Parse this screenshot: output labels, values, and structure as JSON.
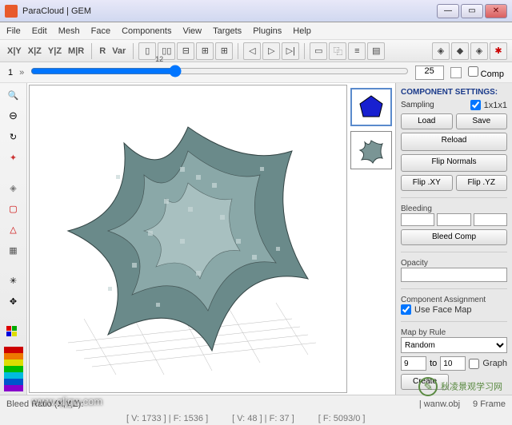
{
  "window": {
    "title": "ParaCloud | GEM"
  },
  "menu": [
    "File",
    "Edit",
    "Mesh",
    "Face",
    "Components",
    "View",
    "Targets",
    "Plugins",
    "Help"
  ],
  "toolbar": {
    "axes": [
      "X|Y",
      "X|Z",
      "Y|Z",
      "M|R"
    ],
    "rv": [
      "R",
      "Var"
    ]
  },
  "slider": {
    "min": "1",
    "value": "12",
    "field": "25",
    "comp": "Comp"
  },
  "panel": {
    "header": "COMPONENT SETTINGS:",
    "sampling": "Sampling",
    "samplingval": "1x1x1",
    "load": "Load",
    "save": "Save",
    "reload": "Reload",
    "flipn": "Flip Normals",
    "flipxy": "Flip .XY",
    "flipyz": "Flip .YZ",
    "bleeding": "Bleeding",
    "bleedcomp": "Bleed Comp",
    "opacity": "Opacity",
    "assign": "Component Assignment",
    "usefacemap": "Use Face Map",
    "mapbyrule": "Map by Rule",
    "ruleval": "Random",
    "from": "9",
    "to_lbl": "to",
    "to": "10",
    "graph": "Graph",
    "create": "Create"
  },
  "status": {
    "bleedratio": "Bleed Ratio (X,Y,Z):",
    "file": "| wanw.obj",
    "frame": "9   Frame",
    "verts": "[ V: 1733 ] | F: 1536 ]",
    "verts2": "[ V: 48 ] | F: 37 ]",
    "verts3": "[ F: 5093/0 ]"
  },
  "watermark": "www.qljgw.com",
  "stamp": "秋凌景观学习网"
}
